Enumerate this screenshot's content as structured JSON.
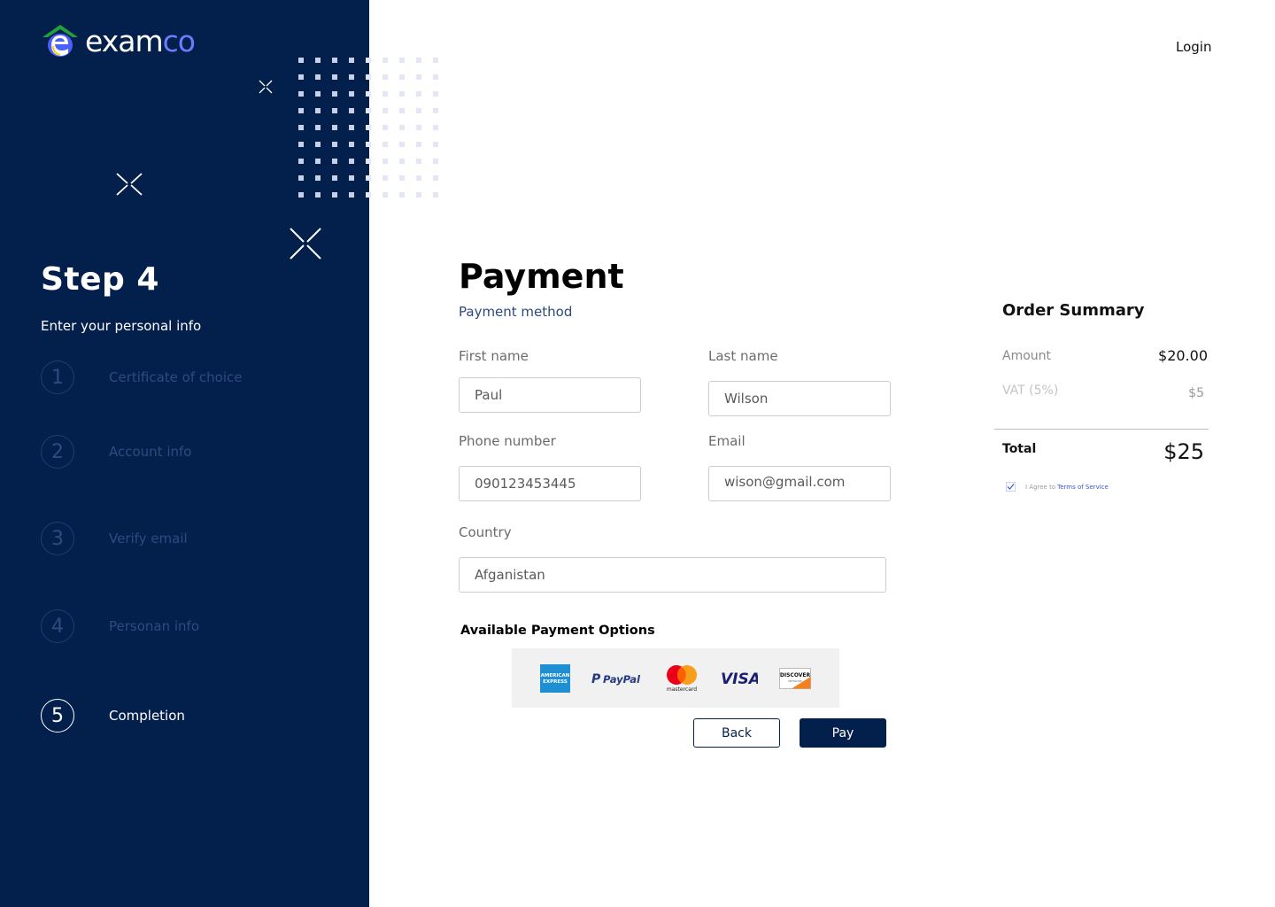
{
  "brand": {
    "name_prefix": "exam",
    "name_suffix": "co",
    "accent": "#6d7bff"
  },
  "sidebar": {
    "title": "Step 4",
    "subtitle": "Enter your personal info",
    "background": "#03204c",
    "steps": [
      {
        "number": "1",
        "label": "Certificate of choice",
        "active": false
      },
      {
        "number": "2",
        "label": "Account info",
        "active": false
      },
      {
        "number": "3",
        "label": "Verify email",
        "active": false
      },
      {
        "number": "4",
        "label": "Personan info",
        "active": false
      },
      {
        "number": "5",
        "label": "Completion",
        "active": true
      }
    ]
  },
  "header": {
    "login_label": "Login"
  },
  "main": {
    "title": "Payment",
    "subtitle": "Payment method",
    "fields": {
      "first_name": {
        "label": "First name",
        "value": "Paul"
      },
      "last_name": {
        "label": "Last name",
        "value": "Wilson"
      },
      "phone": {
        "label": "Phone number",
        "value": "090123453445"
      },
      "email": {
        "label": "Email",
        "value": "wison@gmail.com"
      },
      "country": {
        "label": "Country",
        "value": "Afganistan"
      }
    },
    "payment_options_title": "Available Payment Options",
    "cards": {
      "amex": {
        "name": "amex-card-icon",
        "line1": "AMERICAN",
        "line2": "EXPRESS"
      },
      "paypal": {
        "name": "paypal-card-icon",
        "text": "PayPal"
      },
      "mastercard": {
        "name": "mastercard-card-icon",
        "text": "mastercard"
      },
      "visa": {
        "name": "visa-card-icon",
        "text": "VISA"
      },
      "discover": {
        "name": "discover-card-icon",
        "text": "DISCOVER",
        "sub": "NETWORK"
      }
    },
    "back_label": "Back",
    "pay_label": "Pay"
  },
  "order_summary": {
    "title": "Order Summary",
    "amount_label": "Amount",
    "amount_value": "$20.00",
    "vat_label": "VAT (5%)",
    "vat_value": "$5",
    "total_label": "Total",
    "total_value": "$25",
    "terms_prefix": "I Agree to",
    "terms_link": "Terms of Service",
    "terms_checked": true
  }
}
